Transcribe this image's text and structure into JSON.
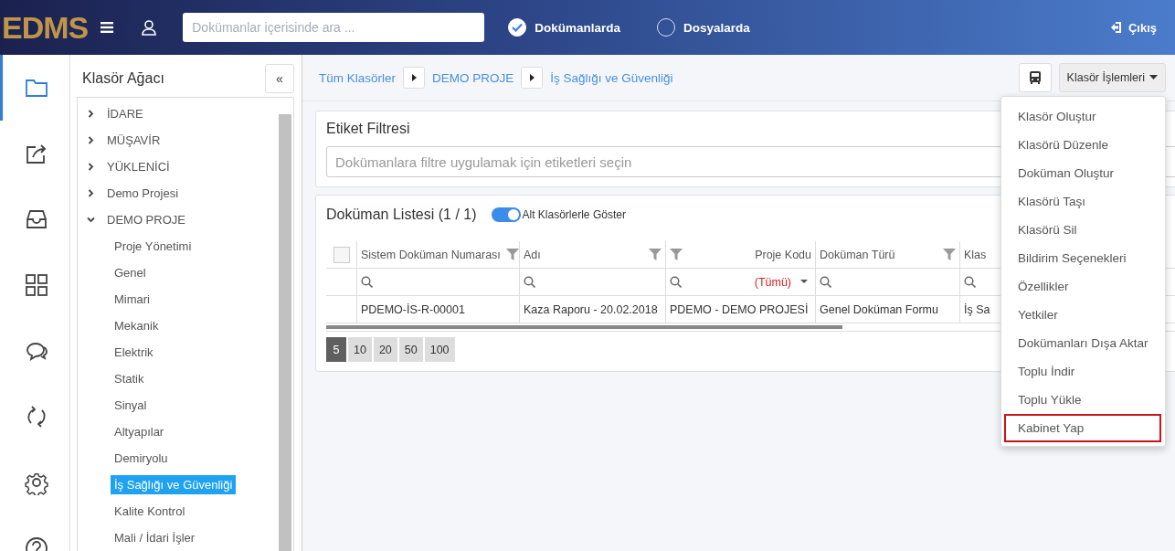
{
  "topbar": {
    "logo": "EDMS",
    "search": {
      "placeholder": "Dokümanlar içerisinde ara ..."
    },
    "scopes": [
      {
        "label": "Dokümanlarda",
        "selected": true
      },
      {
        "label": "Dosyalarda",
        "selected": false
      }
    ],
    "logout": "Çıkış"
  },
  "rail": [
    {
      "kind": "folder",
      "selected": true
    },
    {
      "kind": "share",
      "selected": false
    },
    {
      "kind": "inbox",
      "selected": false
    },
    {
      "kind": "grid",
      "selected": false
    },
    {
      "kind": "chat",
      "selected": false
    },
    {
      "kind": "sync",
      "selected": false
    },
    {
      "kind": "gear",
      "selected": false
    },
    {
      "kind": "help",
      "selected": false
    }
  ],
  "tree": {
    "title": "Klasör Ağacı",
    "collapse": "«",
    "items": [
      {
        "label": "İDARE",
        "expanded": false,
        "selected": false
      },
      {
        "label": "MÜŞAVİR",
        "expanded": false,
        "selected": false
      },
      {
        "label": "YÜKLENİCİ",
        "expanded": false,
        "selected": false
      },
      {
        "label": "Demo Projesi",
        "expanded": false,
        "selected": false
      },
      {
        "label": "DEMO PROJE",
        "expanded": true,
        "selected": false,
        "children": [
          {
            "label": "Proje Yönetimi",
            "selected": false
          },
          {
            "label": "Genel",
            "selected": false
          },
          {
            "label": "Mimari",
            "selected": false
          },
          {
            "label": "Mekanik",
            "selected": false
          },
          {
            "label": "Elektrik",
            "selected": false
          },
          {
            "label": "Statik",
            "selected": false
          },
          {
            "label": "Sinyal",
            "selected": false
          },
          {
            "label": "Altyapılar",
            "selected": false
          },
          {
            "label": "Demiryolu",
            "selected": false
          },
          {
            "label": "İş Sağlığı ve Güvenliği",
            "selected": true
          },
          {
            "label": "Kalite Kontrol",
            "selected": false
          },
          {
            "label": "Mali / İdari İşler",
            "selected": false
          }
        ]
      }
    ]
  },
  "breadcrumb": [
    "Tüm Klasörler",
    "DEMO PROJE",
    "İş Sağlığı ve Güvenliği"
  ],
  "folder_actions": {
    "label": "Klasör İşlemleri",
    "items": [
      {
        "label": "Klasör Oluştur",
        "highlighted": false
      },
      {
        "label": "Klasörü Düzenle",
        "highlighted": false
      },
      {
        "label": "Doküman Oluştur",
        "highlighted": false
      },
      {
        "label": "Klasörü Taşı",
        "highlighted": false
      },
      {
        "label": "Klasörü Sil",
        "highlighted": false
      },
      {
        "label": "Bildirim Seçenekleri",
        "highlighted": false
      },
      {
        "label": "Özellikler",
        "highlighted": false
      },
      {
        "label": "Yetkiler",
        "highlighted": false
      },
      {
        "label": "Dokümanları Dışa Aktar",
        "highlighted": false
      },
      {
        "label": "Toplu İndir",
        "highlighted": false
      },
      {
        "label": "Toplu Yükle",
        "highlighted": false
      },
      {
        "label": "Kabinet Yap",
        "highlighted": true
      }
    ]
  },
  "tag_filter": {
    "title": "Etiket Filtresi",
    "placeholder": "Dokümanlara filtre uygulamak için etiketleri seçin"
  },
  "doc_list": {
    "title": "Doküman Listesi (1 / 1)",
    "toggle": {
      "label": "Alt Klasörlerle Göster",
      "on": true
    },
    "select_all": {
      "checked": false
    },
    "columns": [
      {
        "label": "Sistem Doküman Numarası",
        "kind": "filter-end"
      },
      {
        "label": "Adı",
        "kind": "filter-end"
      },
      {
        "label": "Proje Kodu",
        "kind": "filter-start",
        "filter_value": "(Tümü)"
      },
      {
        "label": "Doküman Türü",
        "kind": "filter-end"
      },
      {
        "label": "Klas",
        "kind": "plain"
      }
    ],
    "rows": [
      {
        "cells": [
          "PDEMO-İS-R-00001",
          "Kaza Raporu - 20.02.2018",
          "PDEMO - DEMO PROJESİ",
          "Genel Doküman Formu",
          "İş Sa"
        ]
      }
    ],
    "page_sizes": [
      {
        "label": "5",
        "selected": true
      },
      {
        "label": "10",
        "selected": false
      },
      {
        "label": "20",
        "selected": false
      },
      {
        "label": "50",
        "selected": false
      },
      {
        "label": "100",
        "selected": false
      }
    ]
  }
}
